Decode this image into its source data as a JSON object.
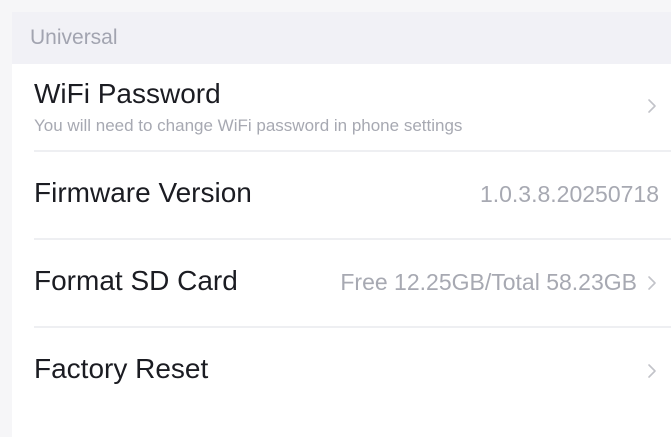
{
  "section": {
    "title": "Universal"
  },
  "items": [
    {
      "label": "WiFi Password",
      "subtitle": "You will need to change WiFi password in phone settings",
      "value": "",
      "icon": "chevron-right-icon"
    },
    {
      "label": "Firmware Version",
      "subtitle": "",
      "value": "1.0.3.8.20250718",
      "icon": ""
    },
    {
      "label": "Format SD Card",
      "subtitle": "",
      "value": "Free 12.25GB/Total 58.23GB",
      "icon": "chevron-right-icon"
    },
    {
      "label": "Factory Reset",
      "subtitle": "",
      "value": "",
      "icon": "chevron-right-icon"
    }
  ],
  "colors": {
    "background": "#f6f6f8",
    "section_background": "#f1f1f6",
    "card_background": "#ffffff",
    "primary_text": "#1b1c22",
    "secondary_text": "#a7a9b2",
    "chevron": "#c2c3c9",
    "divider": "#eeeff2"
  }
}
